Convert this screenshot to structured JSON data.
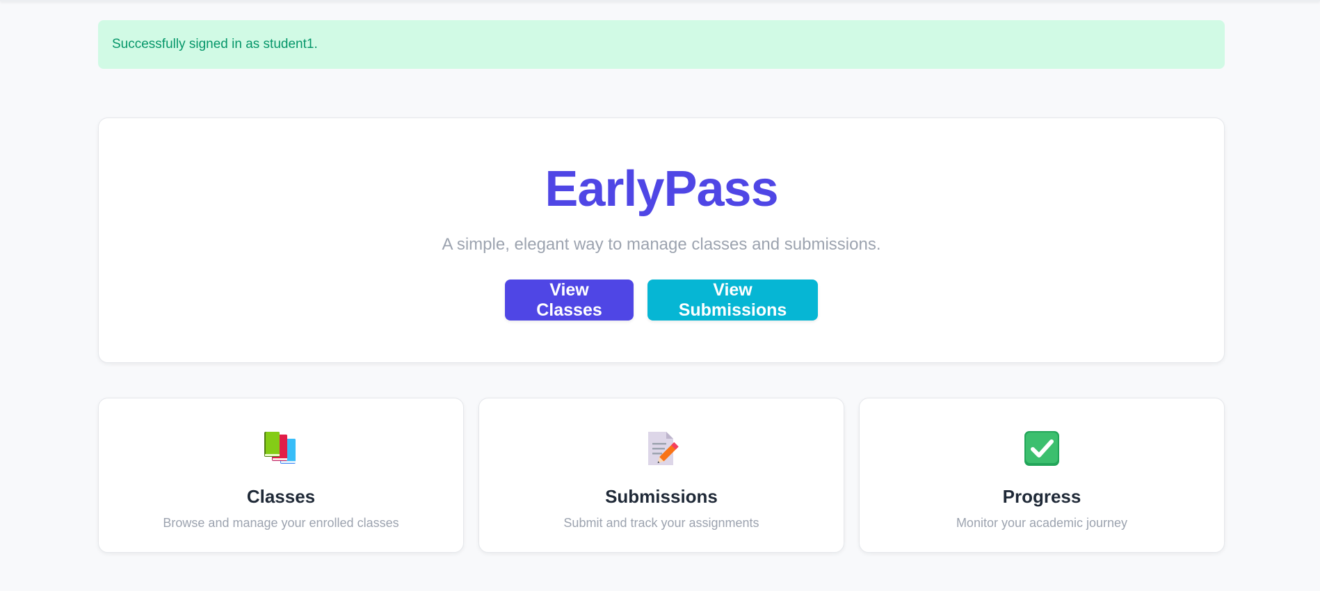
{
  "alert": {
    "message": "Successfully signed in as student1."
  },
  "hero": {
    "title": "EarlyPass",
    "subtitle": "A simple, elegant way to manage classes and submissions.",
    "buttons": {
      "view_classes": "View Classes",
      "view_submissions": "View Submissions"
    }
  },
  "features": [
    {
      "icon": "books-icon",
      "title": "Classes",
      "description": "Browse and manage your enrolled classes"
    },
    {
      "icon": "memo-icon",
      "title": "Submissions",
      "description": "Submit and track your assignments"
    },
    {
      "icon": "check-mark-icon",
      "title": "Progress",
      "description": "Monitor your academic journey"
    }
  ],
  "colors": {
    "brand": "#4f46e5",
    "info": "#06b6d4",
    "success_bg": "#d1fae5",
    "success_text": "#059669"
  }
}
